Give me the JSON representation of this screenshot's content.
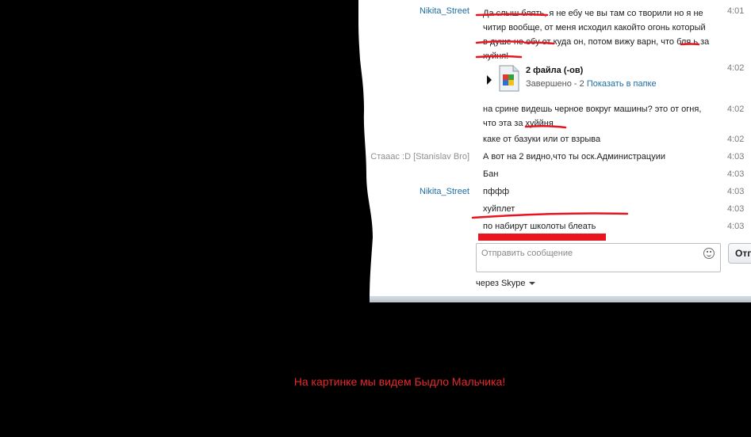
{
  "messages": [
    {
      "sender": "Nikita_Street",
      "sender_style": "blue",
      "lines": [
        "Да слыш блять, я не ебу че вы там со творили но я не",
        "читир вообще, от меня исходил какойто огонь который",
        "в душе не ебу от куда он, потом вижу варн, что бля ь за",
        "хуйня!"
      ],
      "time": "4:01"
    },
    {
      "sender": "",
      "sender_style": "blue",
      "lines": [
        "на срине видешь черное вокруг машины? это от огня,",
        "что эта за хуййня"
      ],
      "time": "4:02"
    },
    {
      "sender": "",
      "sender_style": "blue",
      "lines": [
        "каке от базуки или от взрыва"
      ],
      "time": "4:02"
    },
    {
      "sender": "Стааас :D [Stanislav Bro]",
      "sender_style": "gray",
      "lines": [
        "А вот на 2 видно,что ты оск.Администрацуии"
      ],
      "time": "4:03"
    },
    {
      "sender": "",
      "sender_style": "gray",
      "lines": [
        "Бан"
      ],
      "time": "4:03"
    },
    {
      "sender": "Nikita_Street",
      "sender_style": "blue",
      "lines": [
        "пффф"
      ],
      "time": "4:03"
    },
    {
      "sender": "",
      "sender_style": "blue",
      "lines": [
        "хуйплет"
      ],
      "time": "4:03"
    },
    {
      "sender": "",
      "sender_style": "blue",
      "lines": [
        "по набирут школоты блеать"
      ],
      "time": "4:03"
    }
  ],
  "file_transfer": {
    "title": "2 файла (-ов)",
    "status_prefix": "Завершено - 2",
    "show_in_folder": "Показать в папке",
    "time": "4:02"
  },
  "input": {
    "placeholder": "Отправить сообщение",
    "send_label": "Отп"
  },
  "via_label": "через Skype",
  "caption": "На картинке мы видем Быдло Мальчика!",
  "colors": {
    "annotation_red": "#e8141e",
    "caption_red": "#e8282d",
    "sender_blue": "#1b6ea4"
  }
}
